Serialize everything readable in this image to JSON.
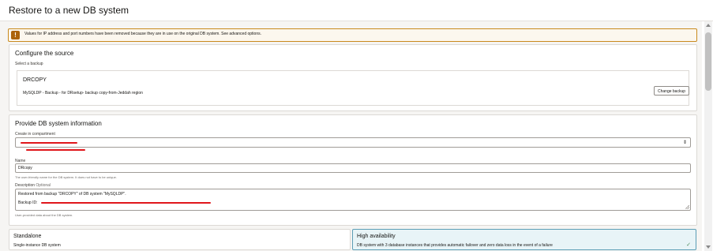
{
  "page": {
    "title": "Restore to a new DB system"
  },
  "notice": {
    "icon": "warning-icon",
    "text": "Values for IP address and port numbers have been removed because they are in use on the original DB system. See advanced options."
  },
  "source": {
    "title": "Configure the source",
    "select_label": "Select a backup",
    "backup_name": "DRCOPY",
    "backup_desc": "MySQLDP - Backup - for DRsetup- backup copy-from-Jeddah region",
    "change_label": "Change backup"
  },
  "info": {
    "title": "Provide DB system information",
    "compartment_label": "Create in compartment",
    "name_label": "Name",
    "name_value": "DRcopy",
    "name_help": "The user-friendly name for the DB system. It does not have to be unique.",
    "description_label": "Description",
    "description_optional": "Optional",
    "description_line1": "Restored from backup \"DRCOPY\" of DB system \"MySQLDP\".",
    "description_line2": "Backup ID:",
    "description_help": "User-provided data about the DB system."
  },
  "tiles": [
    {
      "title": "Standalone",
      "desc": "Single-instance DB system",
      "selected": false
    },
    {
      "title": "High availability",
      "desc": "DB system with 3 database instances that provides automatic failover and zero data loss in the event of a failure",
      "selected": true
    }
  ],
  "colors": {
    "accent_selected": "#5b9db5",
    "warning": "#ac630c",
    "redaction": "#e0161b"
  }
}
